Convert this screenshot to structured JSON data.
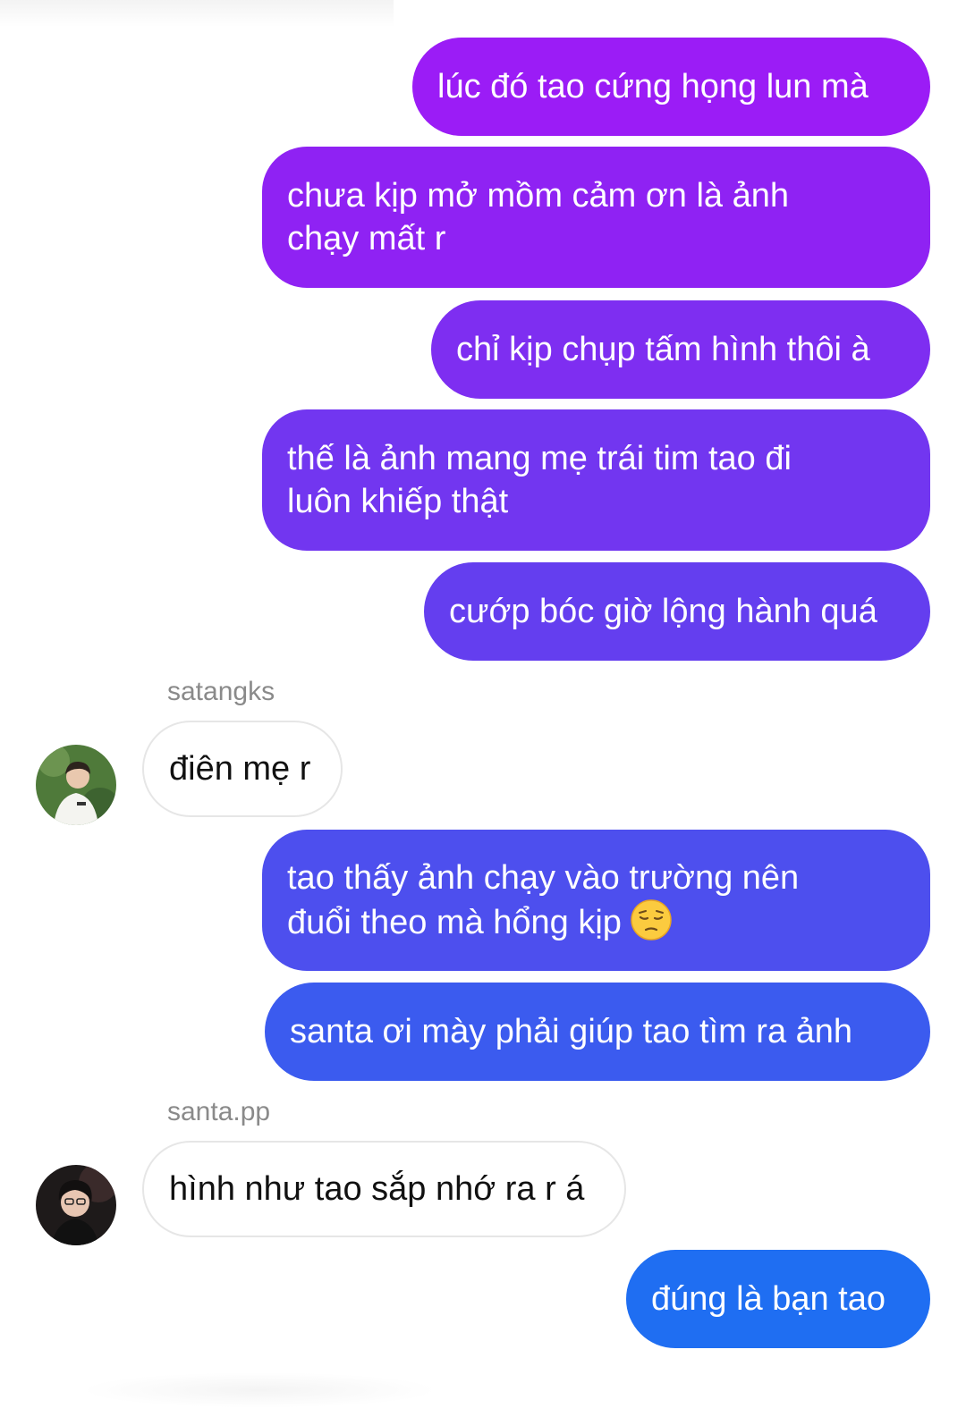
{
  "colors": {
    "outgoing_gradient_top": "#9b1cf6",
    "outgoing_gradient_bottom": "#1f6ef2",
    "incoming_border": "#e6e6e6",
    "sender_label": "#8a8a8a"
  },
  "messages": [
    {
      "direction": "outgoing",
      "text": "lúc đó tao cứng họng lun mà"
    },
    {
      "direction": "outgoing",
      "text": "chưa kịp mở mồm cảm ơn là ảnh\nchạy mất r"
    },
    {
      "direction": "outgoing",
      "text": "chỉ kịp chụp tấm hình thôi à"
    },
    {
      "direction": "outgoing",
      "text": "thế là ảnh mang mẹ trái tim tao đi\nluôn khiếp thật"
    },
    {
      "direction": "outgoing",
      "text": "cướp bóc giờ lộng hành quá"
    },
    {
      "direction": "incoming",
      "sender": "satangks",
      "text": "điên mẹ r",
      "avatar_icon": "user-avatar-photo"
    },
    {
      "direction": "outgoing",
      "text": "tao thấy ảnh chạy vào trường nên\nđuổi theo mà hổng kịp",
      "emoji": "pensive-face-emoji"
    },
    {
      "direction": "outgoing",
      "text": "santa ơi mày phải giúp tao tìm ra ảnh"
    },
    {
      "direction": "incoming",
      "sender": "santa.pp",
      "text": "hình như tao sắp nhớ ra r á",
      "avatar_icon": "user-avatar-photo"
    },
    {
      "direction": "outgoing",
      "text": "đúng là bạn tao"
    }
  ]
}
